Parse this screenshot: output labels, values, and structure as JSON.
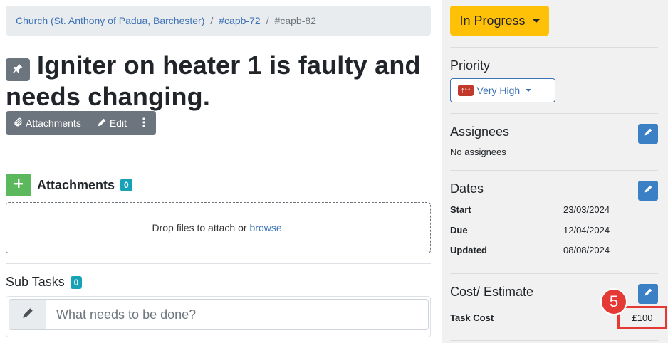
{
  "breadcrumb": {
    "items": [
      "Church (St. Anthony of Padua, Barchester)",
      "#capb-72"
    ],
    "separator": "/",
    "current": "#capb-82"
  },
  "page_title": "Igniter on heater 1 is faulty and needs changing.",
  "toolbar": {
    "attachments_label": "Attachments",
    "edit_label": "Edit"
  },
  "attachments": {
    "label": "Attachments",
    "count": "0",
    "drop_text": "Drop files to attach or",
    "browse_link": "browse."
  },
  "subtasks": {
    "label": "Sub Tasks",
    "count": "0",
    "placeholder": "What needs to be done?"
  },
  "sidebar": {
    "status": "In Progress",
    "priority": {
      "heading": "Priority",
      "arrows": "↑↑↑",
      "value": "Very High"
    },
    "assignees": {
      "heading": "Assignees",
      "value": "No assignees"
    },
    "dates": {
      "heading": "Dates",
      "rows": [
        {
          "label": "Start",
          "value": "23/03/2024"
        },
        {
          "label": "Due",
          "value": "12/04/2024"
        },
        {
          "label": "Updated",
          "value": "08/08/2024"
        }
      ]
    },
    "cost": {
      "heading": "Cost/ Estimate",
      "label": "Task Cost",
      "value": "£100"
    }
  },
  "annotation": {
    "step_number": "5"
  },
  "colors": {
    "status": "#ffc107",
    "link": "#3b72b5",
    "add": "#5cb85c",
    "badge": "#17a2b8",
    "highlight": "#e53935",
    "edit": "#3b80c4"
  }
}
